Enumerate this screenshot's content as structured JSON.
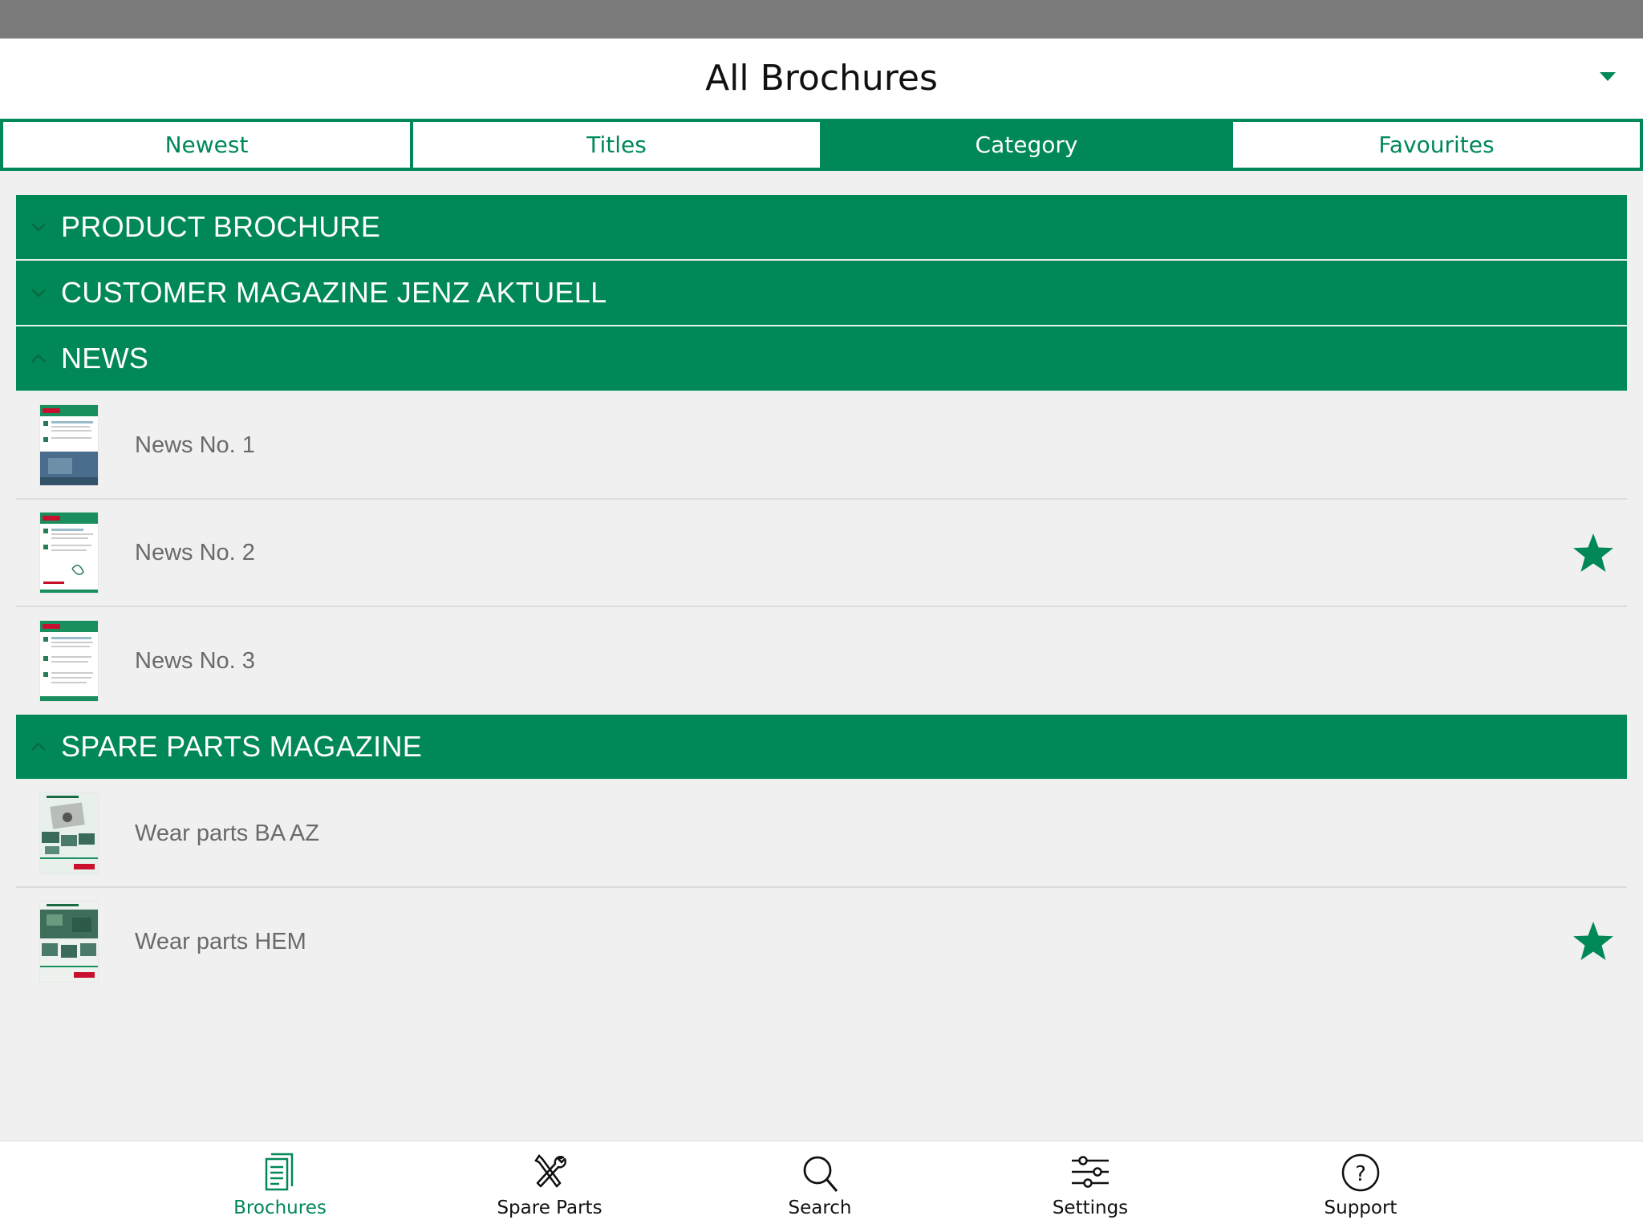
{
  "header": {
    "title": "All Brochures"
  },
  "tabs": [
    {
      "label": "Newest",
      "active": false
    },
    {
      "label": "Titles",
      "active": false
    },
    {
      "label": "Category",
      "active": true
    },
    {
      "label": "Favourites",
      "active": false
    }
  ],
  "categories": [
    {
      "label": "PRODUCT BROCHURE",
      "expanded": false
    },
    {
      "label": "CUSTOMER MAGAZINE JENZ AKTUELL",
      "expanded": false
    },
    {
      "label": "NEWS",
      "expanded": true,
      "items": [
        {
          "label": "News No. 1",
          "favourite": false
        },
        {
          "label": "News No. 2",
          "favourite": true
        },
        {
          "label": "News No. 3",
          "favourite": false
        }
      ]
    },
    {
      "label": "SPARE PARTS MAGAZINE",
      "expanded": true,
      "items": [
        {
          "label": "Wear parts BA AZ",
          "favourite": false
        },
        {
          "label": "Wear parts HEM",
          "favourite": true
        }
      ]
    }
  ],
  "bottom_nav": [
    {
      "label": "Brochures",
      "icon": "brochure-icon",
      "active": true
    },
    {
      "label": "Spare Parts",
      "icon": "tools-icon",
      "active": false
    },
    {
      "label": "Search",
      "icon": "search-icon",
      "active": false
    },
    {
      "label": "Settings",
      "icon": "sliders-icon",
      "active": false
    },
    {
      "label": "Support",
      "icon": "help-icon",
      "active": false
    }
  ],
  "colors": {
    "accent": "#008857",
    "background": "#f0f0f0",
    "item_text": "#6a6a6a"
  }
}
